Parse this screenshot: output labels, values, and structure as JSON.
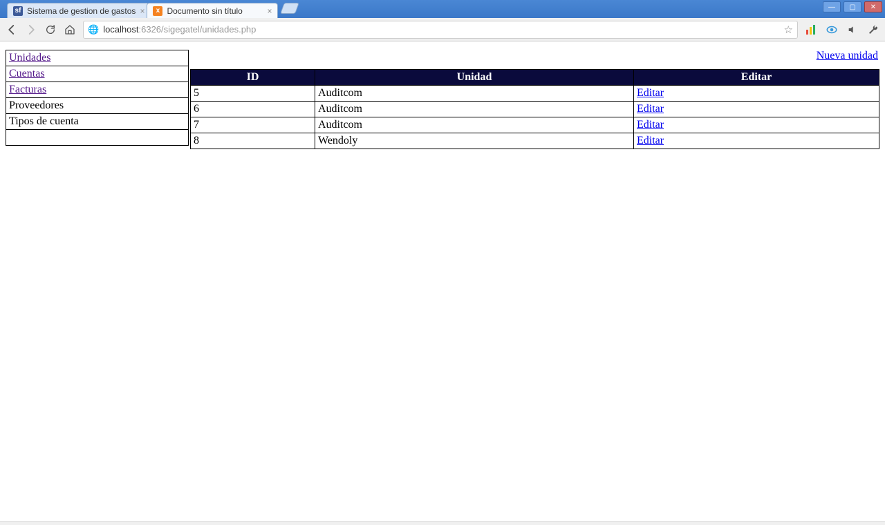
{
  "chrome": {
    "tabs": [
      {
        "title": "Sistema de gestion de gastos",
        "active": false,
        "favicon": "sf"
      },
      {
        "title": "Documento sin título",
        "active": true,
        "favicon": "x"
      }
    ],
    "url": {
      "host": "localhost",
      "port": ":6326",
      "path": "/sigegatel/unidades.php"
    }
  },
  "sidebar": {
    "items": [
      {
        "label": "Unidades",
        "link": true
      },
      {
        "label": "Cuentas",
        "link": true
      },
      {
        "label": "Facturas",
        "link": true
      },
      {
        "label": "Proveedores",
        "link": false
      },
      {
        "label": "Tipos de cuenta",
        "link": false
      },
      {
        "label": "",
        "link": false
      }
    ]
  },
  "main": {
    "new_link": "Nueva unidad",
    "columns": {
      "id": "ID",
      "unidad": "Unidad",
      "editar": "Editar"
    },
    "edit_label": "Editar",
    "rows": [
      {
        "id": "5",
        "unidad": "Auditcom"
      },
      {
        "id": "6",
        "unidad": "Auditcom"
      },
      {
        "id": "7",
        "unidad": "Auditcom"
      },
      {
        "id": "8",
        "unidad": "Wendoly"
      }
    ]
  }
}
